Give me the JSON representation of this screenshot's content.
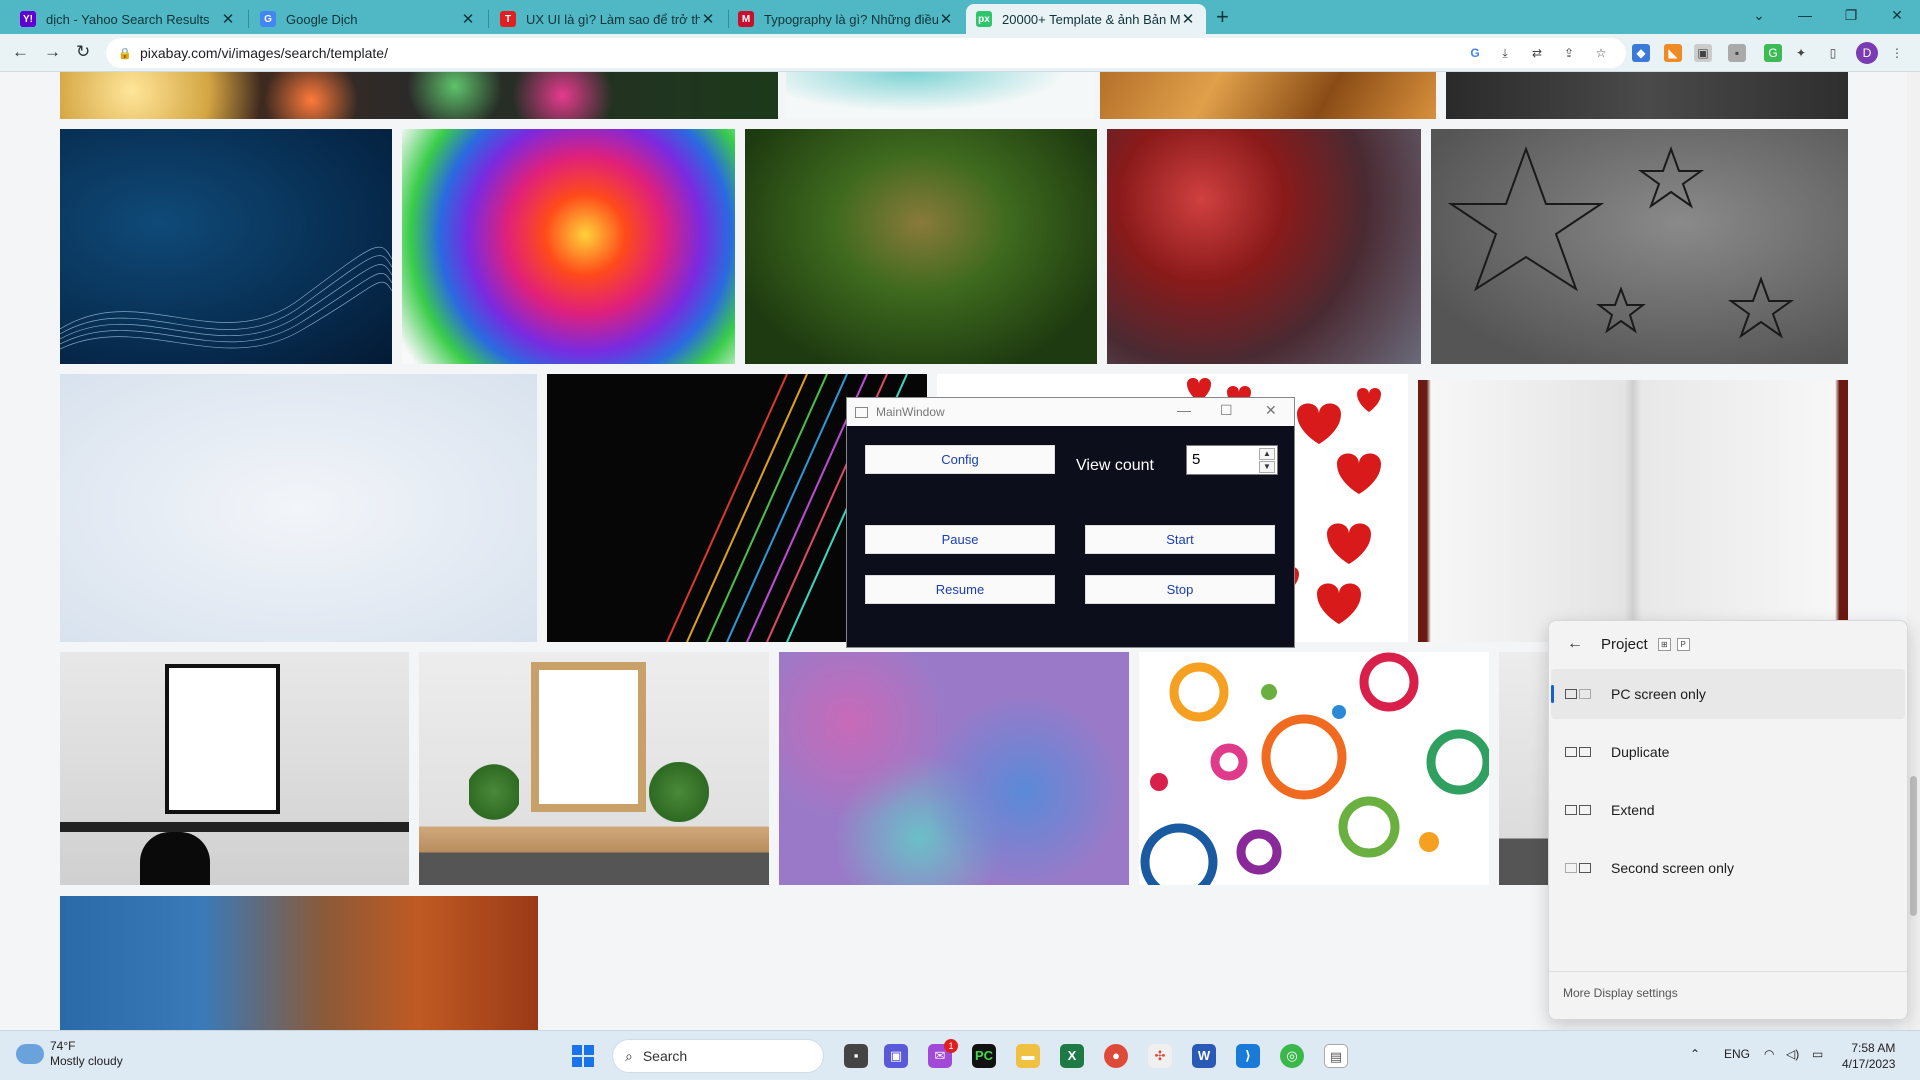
{
  "browser": {
    "tabs": [
      {
        "title": "dịch - Yahoo Search Results",
        "icon": "yahoo-icon",
        "active": false
      },
      {
        "title": "Google Dịch",
        "icon": "google-translate-icon",
        "active": false
      },
      {
        "title": "UX UI là gì? Làm sao để trở thành",
        "icon": "topcv-icon",
        "active": false
      },
      {
        "title": "Typography là gì? Những điều cần",
        "icon": "mbe-icon",
        "active": false
      },
      {
        "title": "20000+ Template & ảnh Bản Mẫ",
        "icon": "pixabay-icon",
        "active": true
      }
    ],
    "url": "pixabay.com/vi/images/search/template/"
  },
  "main_window": {
    "title": "MainWindow",
    "config_label": "Config",
    "view_count_label": "View count",
    "view_count_value": "5",
    "pause_label": "Pause",
    "start_label": "Start",
    "resume_label": "Resume",
    "stop_label": "Stop"
  },
  "project_panel": {
    "title": "Project",
    "key1": "⊞",
    "key2": "P",
    "options": [
      {
        "label": "PC screen only",
        "selected": true
      },
      {
        "label": "Duplicate",
        "selected": false
      },
      {
        "label": "Extend",
        "selected": false
      },
      {
        "label": "Second screen only",
        "selected": false
      }
    ],
    "footer": "More Display settings"
  },
  "taskbar": {
    "temperature": "74°F",
    "weather": "Mostly cloudy",
    "search_label": "Search",
    "language": "ENG",
    "time": "7:58 AM",
    "date": "4/17/2023",
    "notification_count": "1"
  }
}
